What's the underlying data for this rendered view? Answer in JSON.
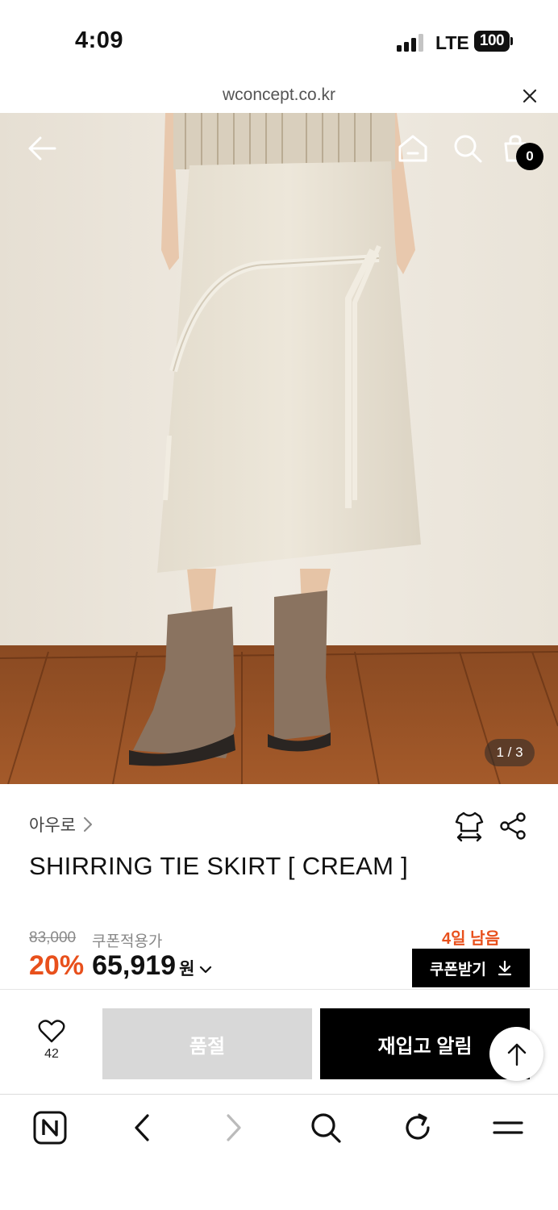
{
  "status_bar": {
    "time": "4:09",
    "network": "LTE",
    "battery": "100"
  },
  "url_bar": {
    "url": "wconcept.co.kr",
    "close_icon": "close-icon"
  },
  "hero": {
    "icons": [
      "back-arrow-icon",
      "home-icon",
      "search-icon",
      "shopping-bag-icon"
    ],
    "cart_count": "0",
    "image_counter": "1 / 3"
  },
  "product": {
    "brand": "아우로",
    "title": "SHIRRING TIE SKIRT [ CREAM ]",
    "original_price": "83,000",
    "coupon_price_label": "쿠폰적용가",
    "days_left": "4일 남음",
    "discount": "20%",
    "price": "65,919",
    "currency": "원",
    "coupon_button": "쿠폰받기",
    "accent_color": "#e8501c"
  },
  "actions": {
    "wishlist_count": "42",
    "soldout_label": "품절",
    "restock_label": "재입고 알림"
  },
  "browser_toolbar": {
    "items": [
      "naver-icon",
      "back-icon",
      "forward-icon",
      "search-icon",
      "reload-icon",
      "menu-icon"
    ]
  }
}
